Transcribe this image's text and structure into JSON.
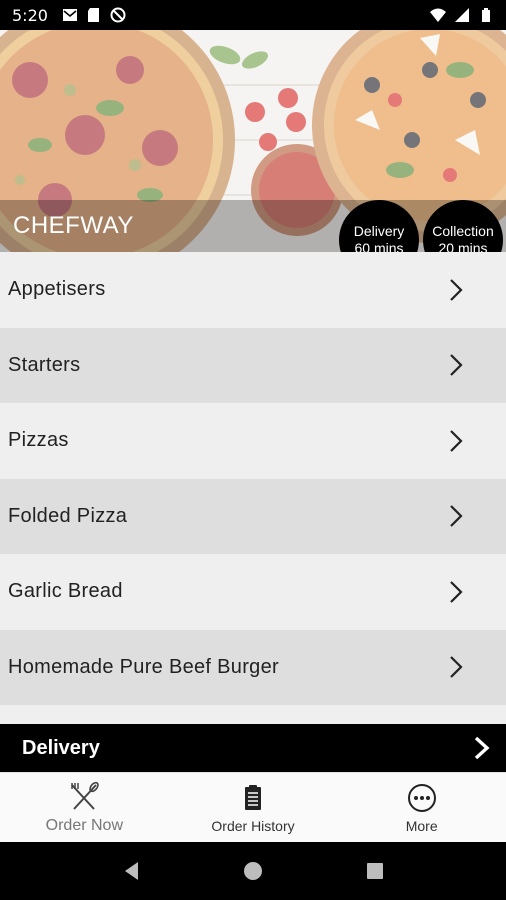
{
  "status_bar": {
    "time": "5:20",
    "left_icons": [
      "mail-icon",
      "sd-card-icon",
      "no-sync-icon"
    ],
    "right_icons": [
      "wifi-icon",
      "signal-icon",
      "battery-icon"
    ]
  },
  "header": {
    "brand": "CHEFWAY",
    "delivery_badge": {
      "line1": "Delivery",
      "line2": "60 mins"
    },
    "collection_badge": {
      "line1": "Collection",
      "line2": "20 mins"
    }
  },
  "menu": {
    "items": [
      {
        "label": "Appetisers"
      },
      {
        "label": "Starters"
      },
      {
        "label": "Pizzas"
      },
      {
        "label": "Folded Pizza"
      },
      {
        "label": "Garlic Bread"
      },
      {
        "label": "Homemade Pure Beef Burger"
      },
      {
        "label": ""
      }
    ]
  },
  "order_mode": {
    "label": "Delivery"
  },
  "tabs": [
    {
      "label": "Order Now",
      "icon": "fork-knife-icon"
    },
    {
      "label": "Order History",
      "icon": "clipboard-icon"
    },
    {
      "label": "More",
      "icon": "more-icon"
    }
  ],
  "colors": {
    "accent": "#000000",
    "row_light": "#efefef",
    "row_dark": "#dedede"
  }
}
